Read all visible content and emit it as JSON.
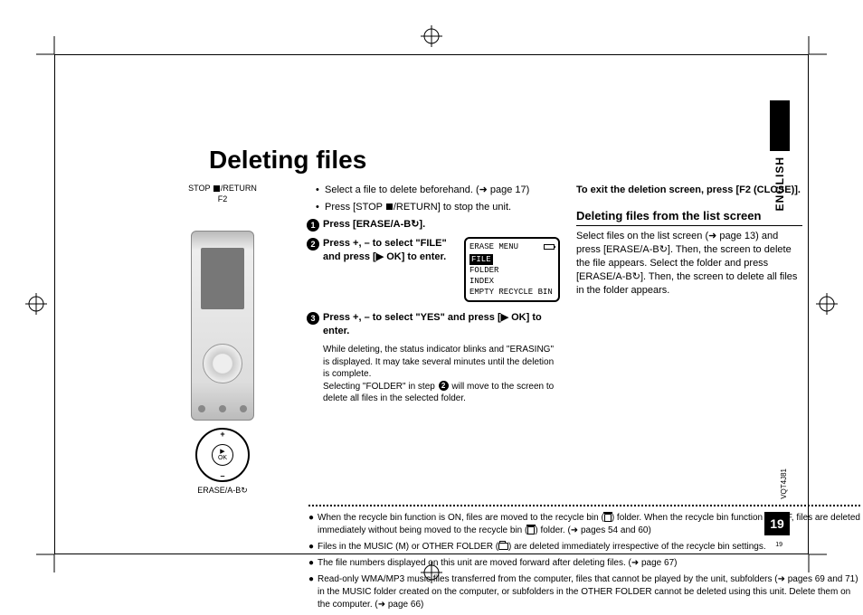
{
  "title": "Deleting files",
  "language": "ENGLISH",
  "doc_code": "VQT4J81",
  "page_number": "19",
  "page_number_small": "19",
  "intro": {
    "b1": "Select a file to delete beforehand. (➜ page 17)",
    "b2_a": "Press [STOP ",
    "b2_b": "/RETURN] to stop the unit."
  },
  "labels": {
    "stop_a": "STOP ",
    "stop_b": "/RETURN",
    "f2": "F2",
    "erase": "ERASE/A-B↻",
    "pad_ok_a": "▶",
    "pad_ok_b": "OK"
  },
  "steps": {
    "s1_a": "Press [",
    "s1_b": "ERASE",
    "s1_c": "/A-B↻].",
    "s2": "Press +, – to select \"FILE\" and press [▶ OK] to enter.",
    "s3": "Press +, – to select \"YES\" and press [▶ OK] to enter.",
    "s3_exp_a": "While deleting, the status indicator blinks and \"ERASING\" is displayed. It may take several minutes until the deletion is complete.",
    "s3_exp_b_1": "Selecting \"FOLDER\" in step ",
    "s3_exp_b_2": " will move to the screen to delete all files in the selected folder."
  },
  "menu": {
    "title": "ERASE MENU",
    "i1": "FILE",
    "i2": "FOLDER",
    "i3": "INDEX",
    "i4": "EMPTY RECYCLE BIN"
  },
  "right": {
    "exit": "To exit the deletion screen, press [F2 (CLOSE)].",
    "subhead": "Deleting files from the list screen",
    "body": "Select files on the list screen (➜ page 13) and press [ERASE/A-B↻]. Then, the screen to delete the file appears. Select the folder and press [ERASE/A-B↻]. Then, the screen to delete all files in the folder appears."
  },
  "notes": {
    "n1_a": "When the recycle bin function is ON, files are moved to the recycle bin (",
    "n1_b": ") folder. When the recycle bin function is OFF, files are deleted immediately without being moved to the recycle bin (",
    "n1_c": ") folder. (➜ pages 54 and 60)",
    "n2_a": "Files in the MUSIC (M) or OTHER FOLDER (",
    "n2_b": ") are deleted immediately irrespective of the recycle bin settings.",
    "n3": "The file numbers displayed on this unit are moved forward after deleting files. (➜ page 67)",
    "n4": "Read-only WMA/MP3 music files transferred from the computer, files that cannot be played by the unit, subfolders (➜ pages 69 and 71) in the MUSIC folder created on the computer, or subfolders in the OTHER FOLDER cannot be deleted using this unit. Delete them on the computer. (➜ page 66)"
  }
}
